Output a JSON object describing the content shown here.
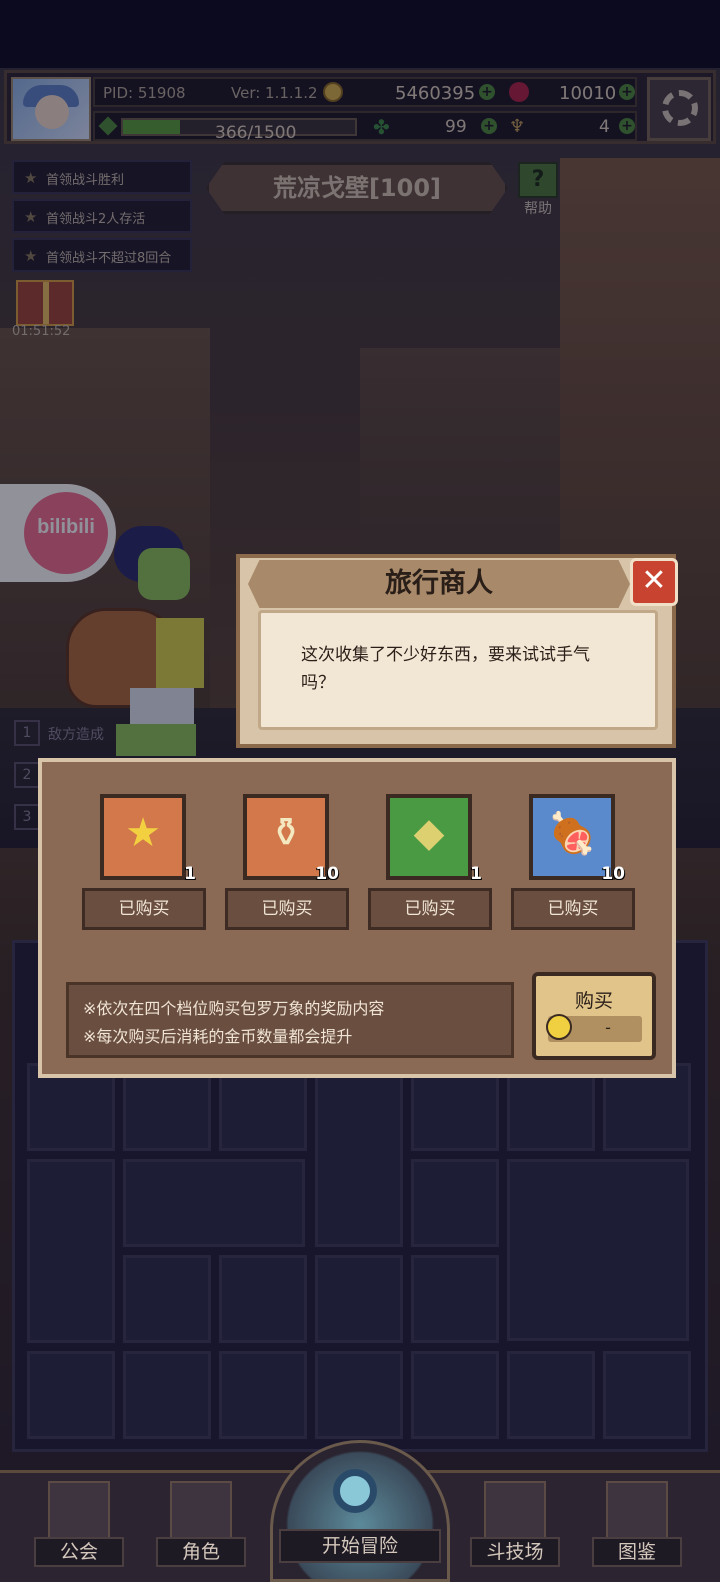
{
  "status_bar": {
    "pid": "PID: 51908",
    "version": "Ver: 1.1.1.2"
  },
  "resources": {
    "gold": "5460395",
    "gems": "10010",
    "xp": "366/1500",
    "xp_progress": 0.244,
    "clovers": "99",
    "horns": "4"
  },
  "quests": [
    "首领战斗胜利",
    "首领战斗2人存活",
    "首领战斗不超过8回合"
  ],
  "stage": {
    "title": "荒凉戈壁[100]",
    "help_label": "帮助"
  },
  "gift_timer": "01:51:52",
  "bilibili_label": "bilibili",
  "side_list": {
    "numbers": [
      "1",
      "2",
      "3"
    ],
    "first_label": "敌方造成"
  },
  "merchant": {
    "title": "旅行商人",
    "close_icon": "close-icon",
    "message": "这次收集了不少好东西，要来试试手气吗？",
    "items": [
      {
        "icon": "star-icon",
        "qty": "1",
        "status": "已购买",
        "bg": "#d2784a"
      },
      {
        "icon": "magic-lamp-icon",
        "qty": "10",
        "status": "已购买",
        "bg": "#d2784a"
      },
      {
        "icon": "green-crystal-icon",
        "qty": "1",
        "status": "已购买",
        "bg": "#4a9a44"
      },
      {
        "icon": "meat-icon",
        "qty": "10",
        "status": "已购买",
        "bg": "#5a8acc"
      }
    ],
    "notes": [
      "※依次在四个档位购买包罗万象的奖励内容",
      "※每次购买后消耗的金币数量都会提升"
    ],
    "buy_label": "购买",
    "buy_price": "-"
  },
  "nav": {
    "guild": "公会",
    "character": "角色",
    "start": "开始冒险",
    "arena": "斗技场",
    "codex": "图鉴"
  }
}
